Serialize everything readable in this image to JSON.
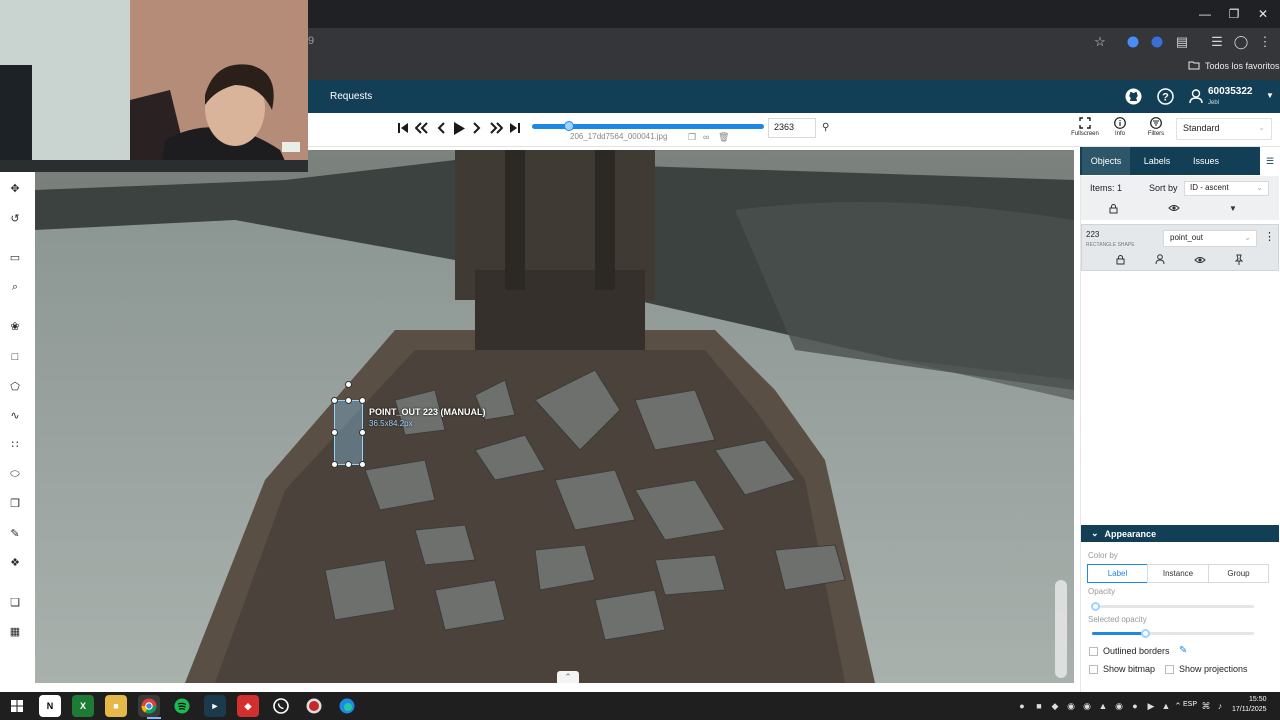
{
  "browser": {
    "url_fragment": "9",
    "favorites_label": "Todos los favoritos",
    "window_controls": [
      "minimize",
      "maximize",
      "close"
    ]
  },
  "header": {
    "requests_label": "Requests",
    "user_id": "60035322",
    "user_name": "Jebl"
  },
  "toolbar": {
    "filename": "206_17dd7564_000041.jpg",
    "frame_number": "2363",
    "progress_fraction": 0.15,
    "fullscreen_label": "Fullscreen",
    "info_label": "Info",
    "filters_label": "Filters",
    "view_mode": "Standard"
  },
  "canvas": {
    "annotation_title": "POINT_OUT 223 (MANUAL)",
    "annotation_size": "36.5x84.2px"
  },
  "sidebar": {
    "tabs": [
      "Objects",
      "Labels",
      "Issues"
    ],
    "items_count": "Items: 1",
    "sort_by_label": "Sort by",
    "sort_value": "ID - ascent",
    "object": {
      "id": "223",
      "type": "RECTANGLE SHAPE",
      "label": "point_out"
    },
    "appearance": {
      "title": "Appearance",
      "color_by_label": "Color by",
      "color_by_options": [
        "Label",
        "Instance",
        "Group"
      ],
      "opacity_label": "Opacity",
      "opacity_value": 0.0,
      "selected_opacity_label": "Selected opacity",
      "selected_opacity_value": 0.3,
      "outlined_borders_label": "Outlined borders",
      "show_bitmap_label": "Show bitmap",
      "show_projections_label": "Show projections"
    }
  },
  "taskbar": {
    "lang": "ESP",
    "time": "15:50",
    "date": "17/11/2025"
  },
  "colors": {
    "app_header": "#123f55",
    "accent": "#1e88e5",
    "annotation_fill": "#8fd3ff"
  }
}
